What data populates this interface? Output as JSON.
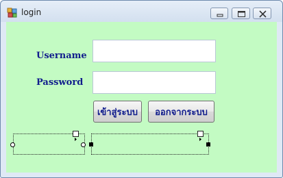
{
  "window": {
    "title": "login",
    "icon": "windows-form-icon",
    "controls": [
      "minimize-icon",
      "maximize-icon",
      "close-icon"
    ]
  },
  "form": {
    "username_label": "Username",
    "password_label": "Password",
    "username_value": "",
    "password_value": "",
    "login_button": "เข้าสู่ระบบ",
    "exit_button": "ออกจากระบบ"
  },
  "colors": {
    "client_background": "#c3fbc3",
    "label_text": "#101c8c",
    "title_bar": "#dfe9f5"
  },
  "designer": {
    "selected_controls": 2
  }
}
